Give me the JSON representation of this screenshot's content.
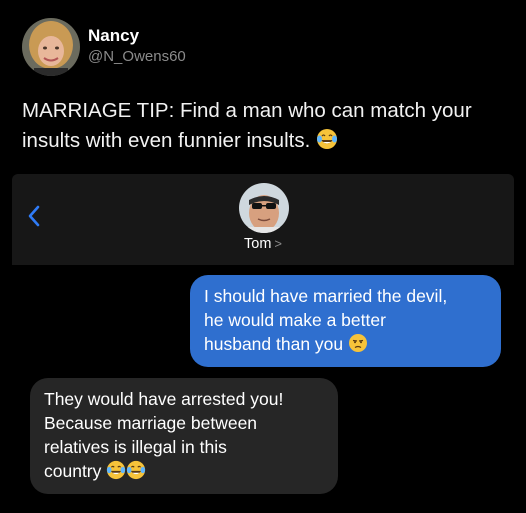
{
  "tweet": {
    "author_name": "Nancy",
    "author_handle": "@N_Owens60",
    "text": "MARRIAGE TIP: Find a man who can match your insults with even funnier insults.",
    "text_emoji": "face-with-tears-of-joy"
  },
  "conversation": {
    "contact_name": "Tom",
    "contact_chevron": ">",
    "messages": [
      {
        "direction": "sent",
        "lines": [
          "I should have married the devil,",
          "he would make a better",
          "husband than you"
        ],
        "emoji": "unamused-face"
      },
      {
        "direction": "received",
        "lines": [
          "They would have arrested you!",
          "Because marriage between",
          "relatives is illegal in this",
          "country"
        ],
        "emoji": "face-with-tears-of-joy x2"
      }
    ]
  },
  "colors": {
    "background": "#000000",
    "handle": "#8b8b8b",
    "header_bar": "#171717",
    "sent_bubble": "#2f6fcf",
    "received_bubble": "#262626",
    "back_chevron": "#2f7bf6"
  }
}
